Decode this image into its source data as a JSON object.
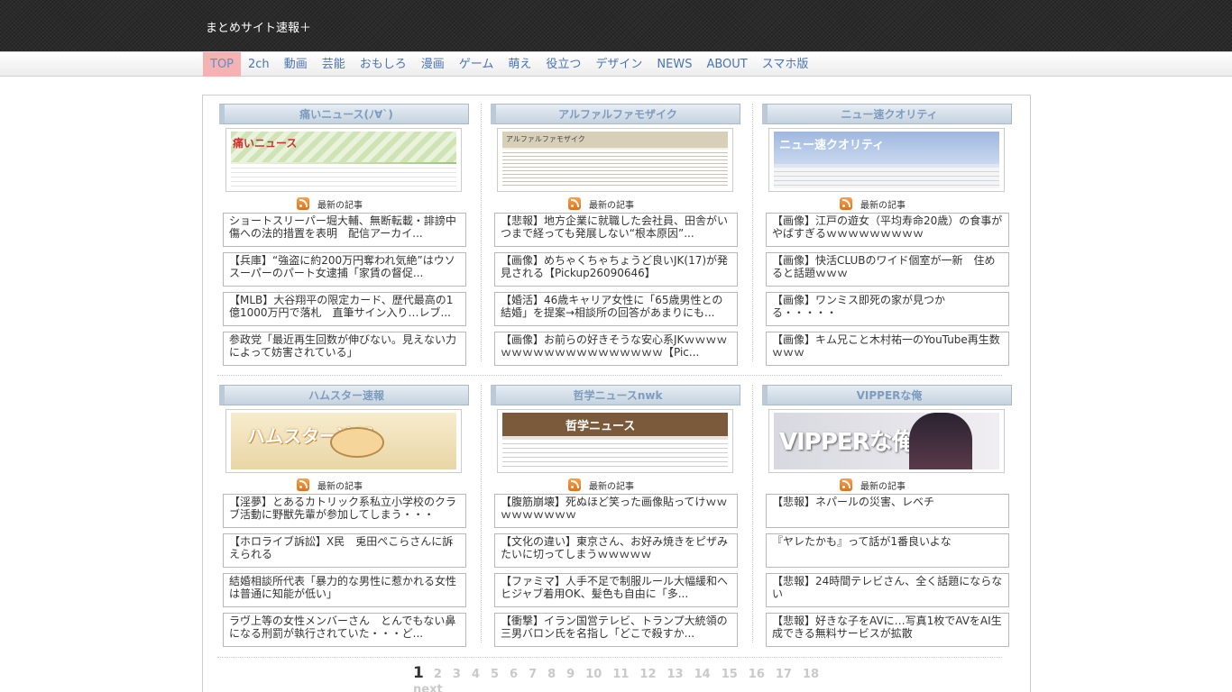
{
  "site": {
    "title": "まとめサイト速報＋"
  },
  "nav": [
    {
      "label": "TOP",
      "active": true
    },
    {
      "label": "2ch"
    },
    {
      "label": "動画"
    },
    {
      "label": "芸能"
    },
    {
      "label": "おもしろ"
    },
    {
      "label": "漫画"
    },
    {
      "label": "ゲーム"
    },
    {
      "label": "萌え"
    },
    {
      "label": "役立つ"
    },
    {
      "label": "デザイン"
    },
    {
      "label": "NEWS"
    },
    {
      "label": "ABOUT"
    },
    {
      "label": "スマホ版"
    }
  ],
  "rss_label": "最新の記事",
  "blocks": [
    {
      "title": "痛いニュース(ﾉ∀`)",
      "thumb_text": "痛いニュース",
      "articles": [
        "ショートスリーパー堀大輔、無断転載・誹謗中傷への法的措置を表明　配信アーカイ...",
        "【兵庫】“強盗に約200万円奪われ気絶”はウソ　スーパーのパート女逮捕「家賃の督促...",
        "【MLB】大谷翔平の限定カード、歴代最高の1億1000万円で落札　直筆サイン入り…レブ...",
        "参政党「最近再生回数が伸びない。見えない力によって妨害されている」"
      ]
    },
    {
      "title": "アルファルファモザイク",
      "thumb_text": "アルファルファモザイク",
      "articles": [
        "【悲報】地方企業に就職した会社員、田舎がいつまで経っても発展しない“根本原因”...",
        "【画像】めちゃくちゃちょうど良いJK(17)が発見される【Pickup26090646】",
        "【婚活】46歳キャリア女性に「65歳男性との結婚」を提案→相談所の回答があまりにも...",
        "【画像】お前らの好きそうな安心系JKｗｗｗｗｗｗｗｗｗｗｗｗｗｗｗｗｗｗｗ【Pic..."
      ]
    },
    {
      "title": "ニュー速クオリティ",
      "thumb_text": "ニュー速クオリティ",
      "articles": [
        "【画像】江戸の遊女（平均寿命20歳）の食事がやばすぎるｗｗｗｗｗｗｗｗｗ",
        "【画像】快活CLUBのワイド個室が一新　住めると話題ｗｗｗ",
        "【画像】ワンミス即死の家が見つかる・・・・・",
        "【画像】キム兄こと木村祐一のYouTube再生数ｗｗｗ"
      ]
    },
    {
      "title": "ハムスター速報",
      "thumb_text": "ハムスター速報",
      "articles": [
        "【淫夢】とあるカトリック系私立小学校のクラブ活動に野獣先輩が参加してしまう・・・",
        "【ホロライブ訴訟】X民　兎田ぺこらさんに訴えられる",
        "結婚相談所代表「暴力的な男性に惹かれる女性は普通に知能が低い」",
        "ラヴ上等の女性メンバーさん　とんでもない鼻になる刑罰が執行されていた・・・ど..."
      ]
    },
    {
      "title": "哲学ニュースnwk",
      "thumb_text": "哲学ニュース",
      "articles": [
        "【腹筋崩壊】死ぬほど笑った画像貼ってけｗｗｗｗｗｗｗｗｗ",
        "【文化の違い】東京さん、お好み焼きをピザみたいに切ってしまうｗｗｗｗｗ",
        "【ファミマ】人手不足で制服ルール大幅緩和へ　ヒジャブ着用OK、髪色も自由に「多...",
        "【衝撃】イラン国営テレビ、トランプ大統領の三男バロン氏を名指し「どこで殺すか..."
      ]
    },
    {
      "title": "VIPPERな俺",
      "thumb_text": "VIPPERな俺",
      "articles": [
        "【悲報】ネパールの災害、レベチ",
        "『ヤレたかも』って話が1番良いよな",
        "【悲報】24時間テレビさん、全く話題にならない",
        "【悲報】好きな子をAVに…写真1枚でAVをAI生成できる無料サービスが拡散"
      ]
    }
  ],
  "pagination": {
    "current": "1",
    "pages": [
      "2",
      "3",
      "4",
      "5",
      "6",
      "7",
      "8",
      "9",
      "10",
      "11",
      "12",
      "13",
      "14",
      "15",
      "16",
      "17",
      "18"
    ],
    "next": "next"
  }
}
